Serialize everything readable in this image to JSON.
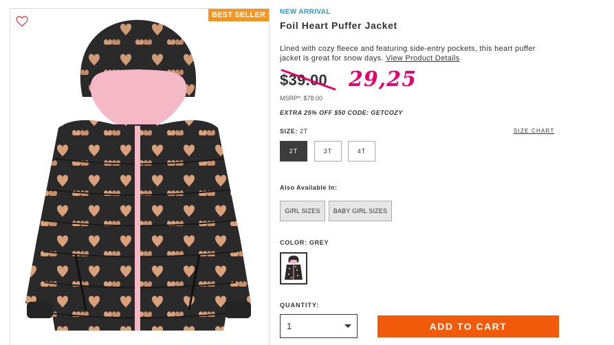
{
  "product": {
    "badge": "BEST SELLER",
    "new_arrival": "NEW ARRIVAL",
    "title": "Foil Heart Puffer Jacket",
    "description": "Lined with cozy fleece and featuring side-entry pockets, this heart puffer jacket is great for snow days.",
    "details_link": "View Product Details",
    "old_price": "$39.00",
    "new_price": "29,25",
    "msrp": "MSRP*: $78.00",
    "promo": "EXTRA 25% OFF $50 CODE: GETCOZY"
  },
  "size": {
    "label": "SIZE:",
    "selected": "2T",
    "chart_link": "SIZE CHART",
    "options": [
      "2T",
      "3T",
      "4T"
    ]
  },
  "also_available": {
    "label": "Also Available In:",
    "options": [
      "GIRL SIZES",
      "BABY GIRL SIZES"
    ]
  },
  "color": {
    "label": "COLOR:",
    "selected": "GREY"
  },
  "quantity": {
    "label": "QUANTITY:",
    "value": "1"
  },
  "cart": {
    "button_label": "ADD TO CART"
  },
  "colors": {
    "accent_orange": "#f05a0a",
    "badge_orange": "#f7941d",
    "new_arrival_blue": "#1e9bd7",
    "price_pink": "#e6006e",
    "jacket_black": "#2a2a2a",
    "jacket_lining_pink": "#f4b8c6",
    "heart_gold": "#d9a07a"
  },
  "icons": {
    "wishlist": "heart-outline-icon",
    "dropdown": "chevron-down-icon"
  }
}
